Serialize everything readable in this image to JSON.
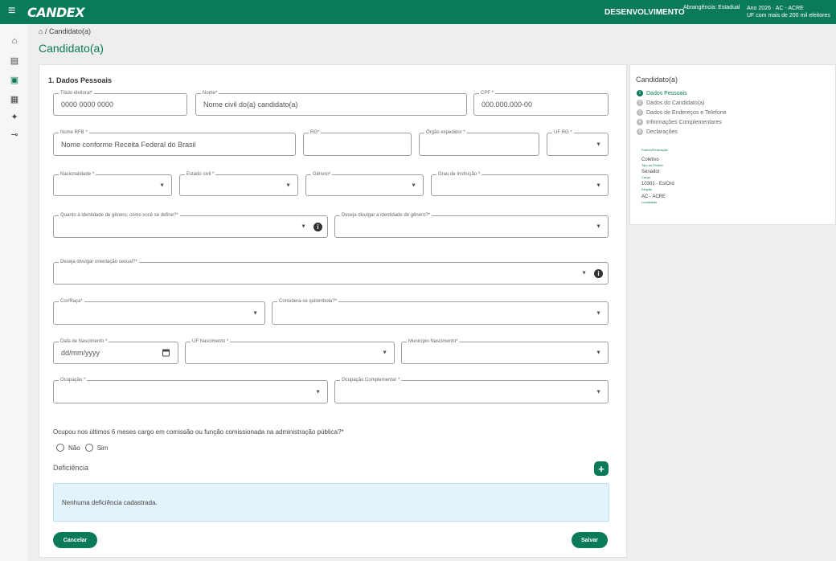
{
  "topbar": {
    "menu_icon": "≡",
    "logo": "CANDEX",
    "environment": "DESENVOLVIMENTO",
    "scope": "Abrangência: Estadual",
    "year_line": "Ano 2026 · AC - ACRE",
    "uf_line": "UF com mais de 200 mil eleitores"
  },
  "leftnav": {
    "icons": [
      "home-icon",
      "document-icon",
      "briefcase-icon",
      "printer-icon",
      "settings-group-icon",
      "key-icon"
    ],
    "glyphs": [
      "⌂",
      "▤",
      "▣",
      "▦",
      "✦",
      "⊸"
    ]
  },
  "breadcrumb": {
    "home_icon": "⌂",
    "separator": "/",
    "current": "Candidato(a)"
  },
  "page_title": "Candidato(a)",
  "form": {
    "section_title": "1. Dados Pessoais",
    "fields": {
      "titulo": {
        "label": "Título eleitoral*",
        "value": "0000 0000 0000"
      },
      "nome": {
        "label": "Nome*",
        "value": "Nome civil do(a) candidato(a)"
      },
      "cpf": {
        "label": "CPF *",
        "value": "000.000.000-00"
      },
      "nome_rfb": {
        "label": "Nome RFB *",
        "value": "Nome conforme Receita Federal do Brasil"
      },
      "rg": {
        "label": "RG*",
        "value": ""
      },
      "orgao": {
        "label": "Órgão expedidor *",
        "value": ""
      },
      "uf_rg": {
        "label": "UF RG *",
        "value": ""
      },
      "nacionalidade": {
        "label": "Nacionalidade *",
        "value": ""
      },
      "estado_civil": {
        "label": "Estado civil *",
        "value": ""
      },
      "genero": {
        "label": "Gênero*",
        "value": ""
      },
      "grau": {
        "label": "Grau de Instrução *",
        "value": ""
      },
      "identidade_genero": {
        "label": "Quanto à identidade de gênero, como você se define?*",
        "value": ""
      },
      "divulgar_genero": {
        "label": "Deseja divulgar a identidade de gênero?*",
        "value": ""
      },
      "orientacao": {
        "label": "Deseja divulgar orientação sexual?*",
        "value": ""
      },
      "cor_raca": {
        "label": "Cor/Raça*",
        "value": ""
      },
      "quilombola": {
        "label": "Considera-se quilombola?*",
        "value": ""
      },
      "nascimento": {
        "label": "Data de Nascimento *",
        "value": "dd/mm/yyyy"
      },
      "uf_nasc": {
        "label": "UF Nascimento *",
        "value": ""
      },
      "municipio_nasc": {
        "label": "Município Nascimento*",
        "value": ""
      },
      "ocupacao": {
        "label": "Ocupação *",
        "value": ""
      },
      "ocupacao_compl": {
        "label": "Ocupação Complementar *",
        "value": ""
      }
    },
    "question": "Ocupou nos últimos 6 meses cargo em comissão ou função comissionada na administração pública?*",
    "radio_no": "Não",
    "radio_yes": "Sim",
    "deficiency_title": "Deficiência",
    "add_icon": "+",
    "deficiency_empty": "Nenhuma deficiência cadastrada.",
    "cancel_label": "Cancelar",
    "save_label": "Salvar"
  },
  "sidebar": {
    "title": "Candidato(a)",
    "steps": [
      {
        "num": "1",
        "label": "Dados Pessoais"
      },
      {
        "num": "2",
        "label": "Dados do Candidato(a)"
      },
      {
        "num": "3",
        "label": "Dados de Endereços e Telefone"
      },
      {
        "num": "4",
        "label": "Informações Complementares"
      },
      {
        "num": "5",
        "label": "Declarações"
      }
    ],
    "partido_label": "Partido/Federação",
    "coletivo": "Coletivo",
    "tipo_pedido": "Tipo do Pedido",
    "cargo_value": "Senador",
    "cargo_label": "Cargo",
    "eleicao_value": "10301 - EstOrd",
    "eleicao_label": "Eleição",
    "local_value": "AC - ACRE",
    "local_label": "Localidade"
  },
  "colors": {
    "brand": "#0b7a58",
    "info_bg": "#e3f3fb"
  }
}
